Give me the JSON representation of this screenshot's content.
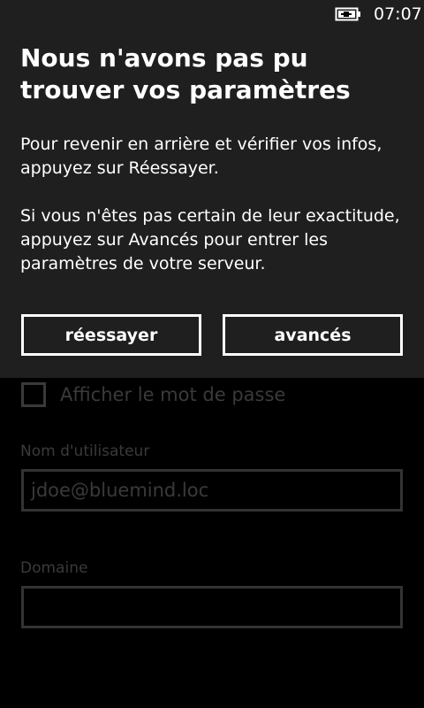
{
  "status_bar": {
    "time": "07:07",
    "battery_icon": "battery-charging-icon"
  },
  "dialog": {
    "title": "Nous n'avons pas pu trouver vos paramètres",
    "paragraph1": "Pour revenir en arrière et vérifier vos infos, appuyez sur Réessayer.",
    "paragraph2": "Si vous n'êtes pas certain de leur exactitude, appuyez sur Avancés pour entrer les paramètres de votre serveur.",
    "retry_label": "réessayer",
    "advanced_label": "avancés"
  },
  "form": {
    "show_password_label": "Afficher le mot de passe",
    "show_password_checked": false,
    "username_label": "Nom d'utilisateur",
    "username_value": "jdoe@bluemind.loc",
    "domain_label": "Domaine",
    "domain_value": ""
  }
}
